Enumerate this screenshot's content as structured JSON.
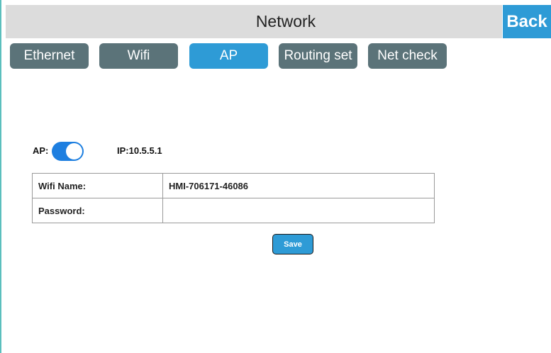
{
  "header": {
    "title": "Network",
    "back_label": "Back"
  },
  "tabs": [
    {
      "label": "Ethernet",
      "active": false
    },
    {
      "label": "Wifi",
      "active": false
    },
    {
      "label": "AP",
      "active": true
    },
    {
      "label": "Routing set",
      "active": false
    },
    {
      "label": "Net check",
      "active": false
    }
  ],
  "ap": {
    "label": "AP:",
    "enabled": true,
    "ip": "IP:10.5.5.1"
  },
  "form": {
    "wifi_name_label": "Wifi Name:",
    "wifi_name_value": "HMI-706171-46086",
    "password_label": "Password:",
    "password_value": ""
  },
  "save_label": "Save",
  "colors": {
    "accent": "#2e9bd6",
    "tab_inactive": "#5b7379",
    "toggle_on": "#1e7fe0",
    "header_bg": "#dcdcdc"
  }
}
